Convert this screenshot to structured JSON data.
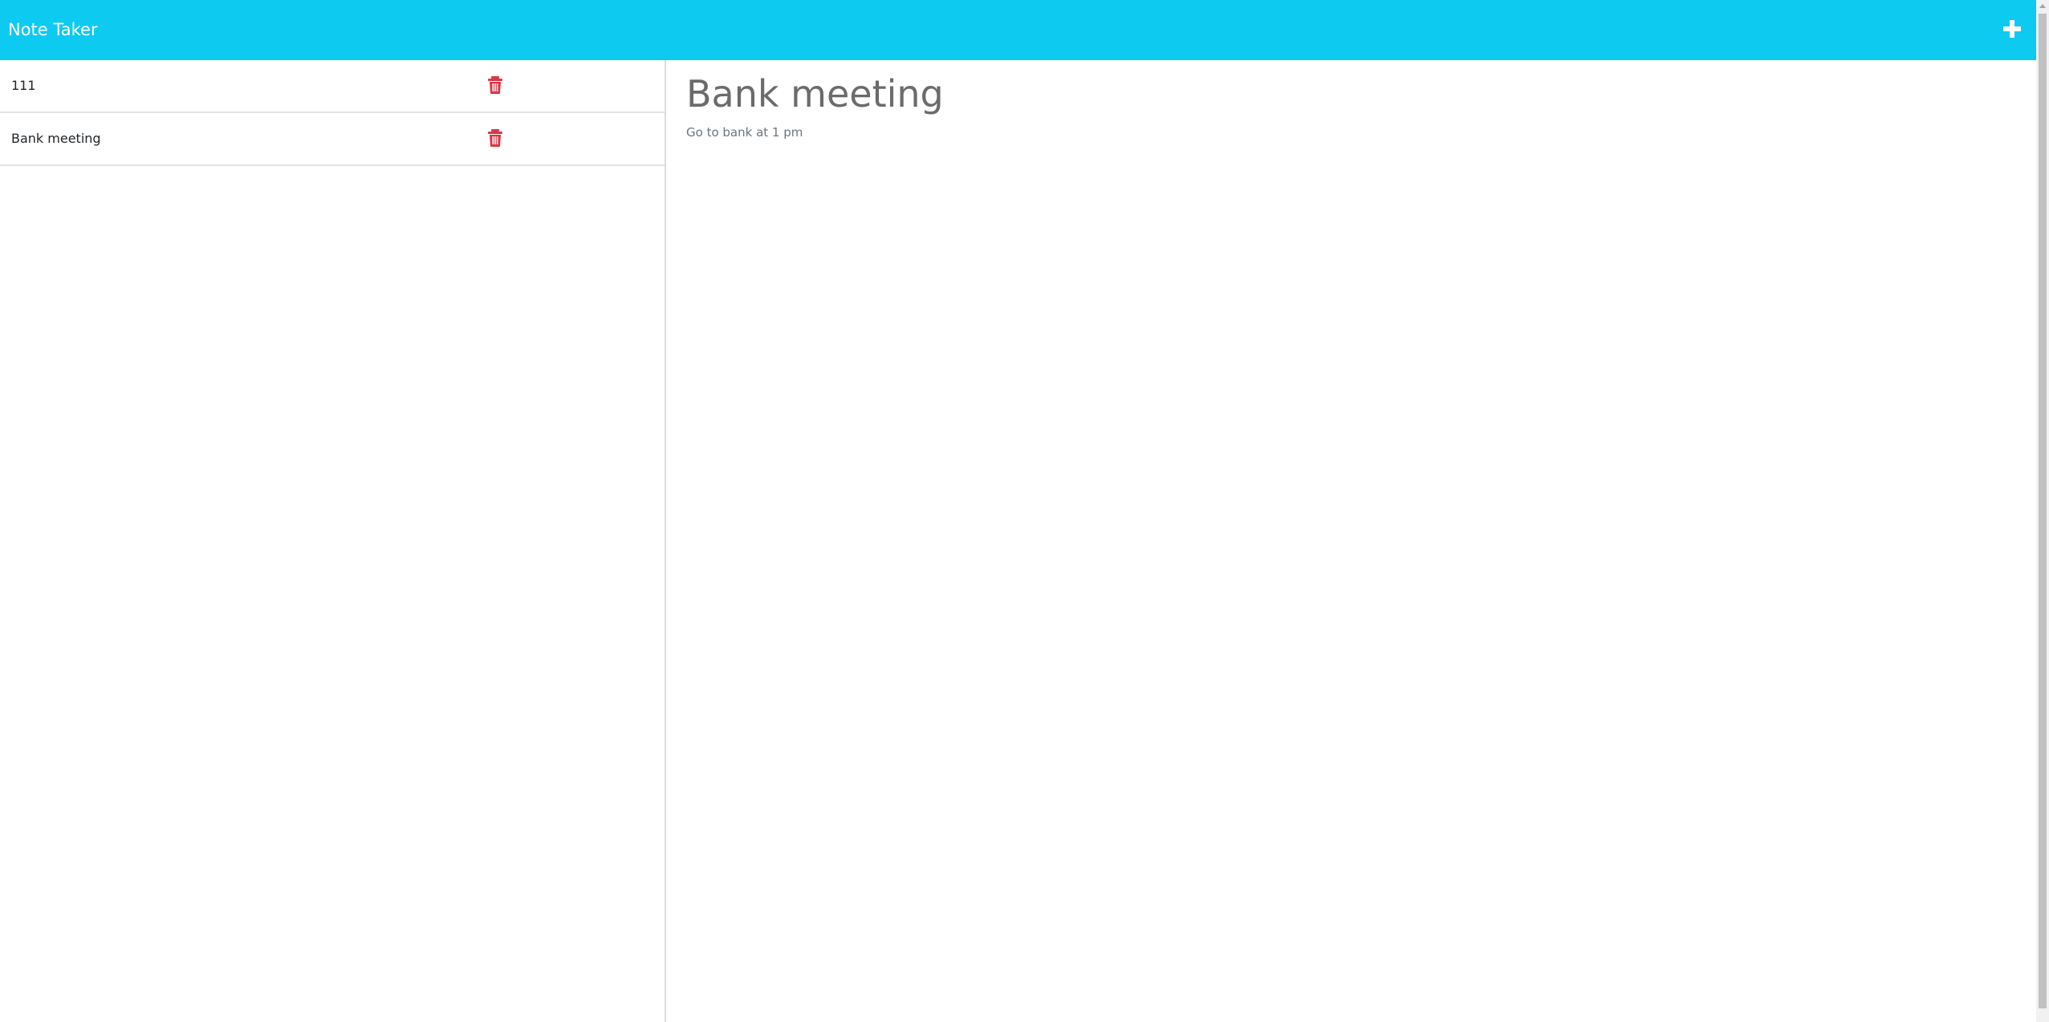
{
  "navbar": {
    "brand": "Note Taker",
    "new_note_icon": "plus-icon",
    "color": "#0dcaf0"
  },
  "notes": [
    {
      "title": "111",
      "delete_icon": "trash-icon"
    },
    {
      "title": "Bank meeting",
      "delete_icon": "trash-icon"
    }
  ],
  "active_note": {
    "title": "Bank meeting",
    "text": "Go to bank at 1 pm"
  },
  "colors": {
    "delete": "#dc3545",
    "title_text": "#6b6b6b"
  }
}
